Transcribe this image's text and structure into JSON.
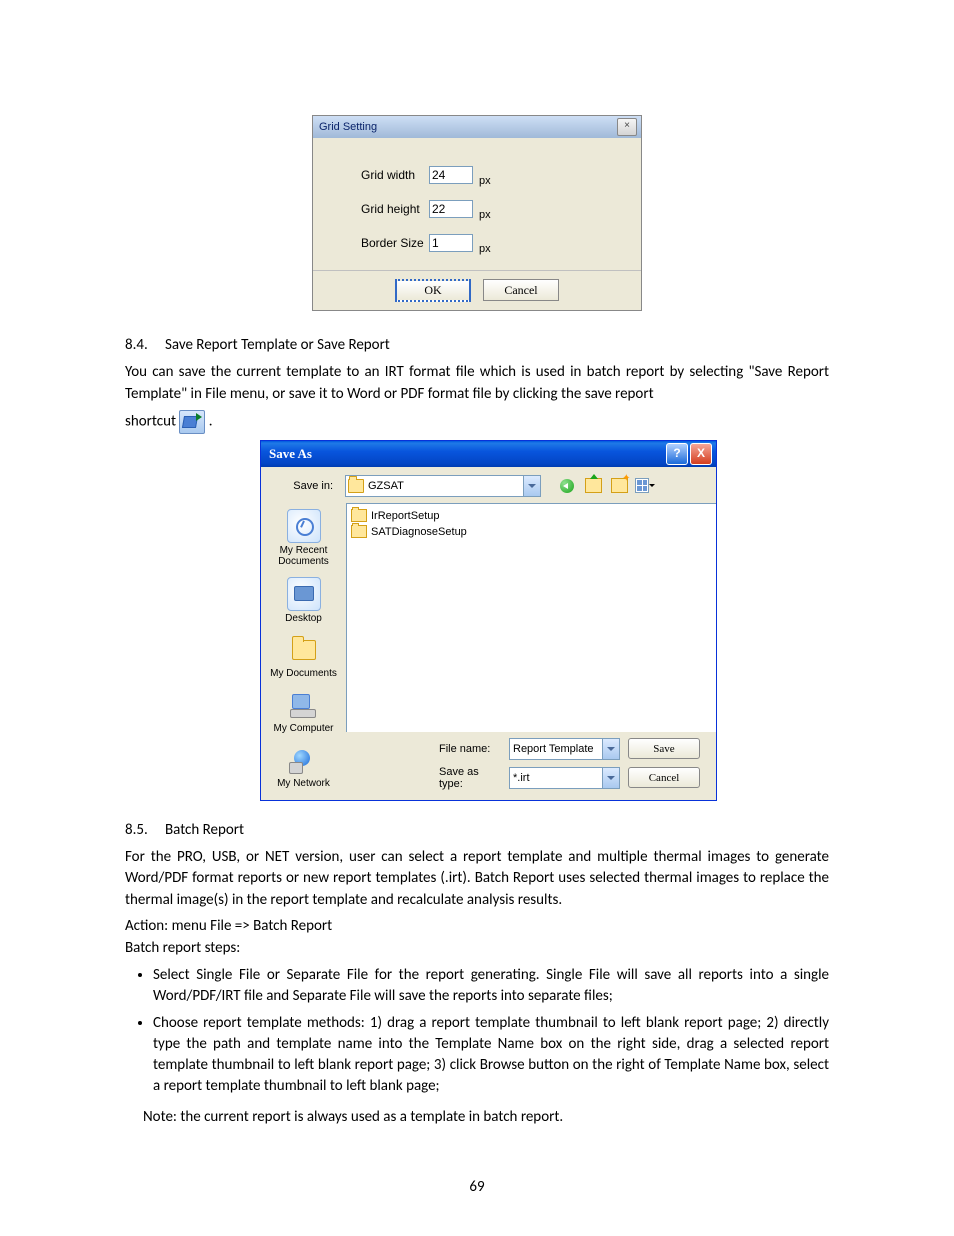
{
  "gridSetting": {
    "title": "Grid Setting",
    "rows": [
      {
        "label": "Grid width",
        "value": "24",
        "unit": "px"
      },
      {
        "label": "Grid height",
        "value": "22",
        "unit": "px"
      },
      {
        "label": "Border Size",
        "value": "1",
        "unit": "px"
      }
    ],
    "ok": "OK",
    "cancel": "Cancel"
  },
  "section84": {
    "num": "8.4.",
    "title": "Save Report Template or Save Report",
    "para_a": "You can save the current template to an IRT format file which is used in batch report by selecting \"Save Report Template\" in File menu, or save it to Word or PDF format file by clicking the save report",
    "para_b_prefix": "shortcut ",
    "para_b_suffix": " ."
  },
  "saveAs": {
    "title": "Save As",
    "saveInLabel": "Save in:",
    "saveInValue": "GZSAT",
    "places": [
      {
        "id": "recent",
        "label": "My Recent Documents"
      },
      {
        "id": "desktop",
        "label": "Desktop"
      },
      {
        "id": "mydocs",
        "label": "My Documents"
      },
      {
        "id": "mycomp",
        "label": "My Computer"
      },
      {
        "id": "network",
        "label": "My Network"
      }
    ],
    "files": [
      "IrReportSetup",
      "SATDiagnoseSetup"
    ],
    "fileNameLabel": "File name:",
    "fileNameValue": "Report Template",
    "saveTypeLabel": "Save as type:",
    "saveTypeValue": "*.irt",
    "save": "Save",
    "cancel": "Cancel"
  },
  "section85": {
    "num": "8.5.",
    "title": "Batch Report",
    "p1": "For the PRO, USB, or NET version, user can select a report template and multiple thermal images to generate Word/PDF format reports or new report templates (.irt). Batch Report uses selected thermal images to replace the thermal image(s) in the report template and recalculate analysis results.",
    "p2": "Action: menu File => Batch Report",
    "p3": "Batch report steps:",
    "b1": "Select Single File or Separate File for the report generating. Single File will save all reports into a single Word/PDF/IRT file and Separate File will save the reports into separate files;",
    "b2": "Choose report template methods: 1)  drag a report template thumbnail to left blank report page;   2) directly type the path and template name into the Template Name box on the right side, drag a selected report template thumbnail to left blank report page; 3) click Browse button on the right of Template Name box, select a report template thumbnail to left blank page;",
    "note": "Note: the current report is always used as a template in batch report."
  },
  "pageNumber": "69"
}
